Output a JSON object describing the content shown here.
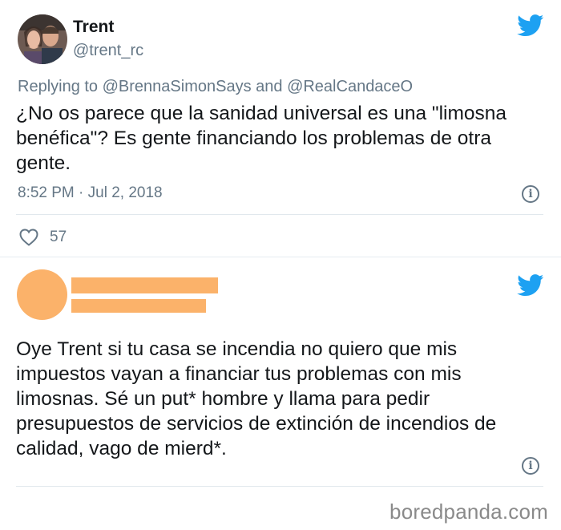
{
  "tweet1": {
    "name": "Trent",
    "handle": "@trent_rc",
    "reply_prefix": "Replying to ",
    "reply_mention_1": "@BrennaSimonSays",
    "reply_and": " and ",
    "reply_mention_2": "@RealCandaceO",
    "text": "¿No os parece que la sanidad universal es una \"limosna benéfica\"? Es gente financiando los problemas de otra gente.",
    "timestamp": "8:52 PM · Jul 2, 2018",
    "likes": "57",
    "info_glyph": "i"
  },
  "tweet2": {
    "text": "Oye Trent si tu casa se incendia no quiero que mis impuestos vayan a financiar tus problemas con mis limosnas. Sé un put* hombre y llama para pedir presupuestos de servicios de extinción de incendios de calidad, vago de mierd*.",
    "info_glyph": "i"
  },
  "footer": {
    "watermark": "boredpanda.com"
  },
  "colors": {
    "twitter_blue": "#1da1f2",
    "redaction": "#fbb26a",
    "secondary_text": "#657786"
  }
}
